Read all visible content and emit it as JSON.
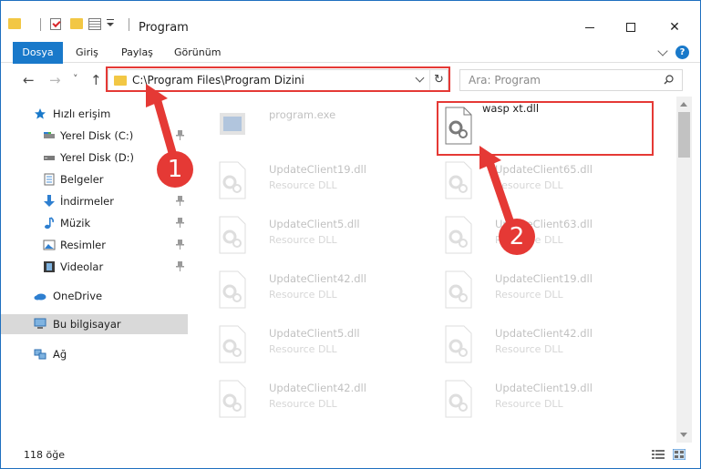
{
  "window": {
    "title": "Program",
    "quick_access_dropdown": "▾",
    "minimize": "—",
    "maximize": "☐",
    "close": "✕"
  },
  "ribbon": {
    "tabs": [
      "Dosya",
      "Giriş",
      "Paylaş",
      "Görünüm"
    ],
    "help": "?"
  },
  "address_bar": {
    "back": "←",
    "forward": "→",
    "recent": "˅",
    "up": "↑",
    "path": "C:\\Program Files\\Program Dizini",
    "refresh": "↻"
  },
  "search": {
    "placeholder": "Ara: Program"
  },
  "sidebar": {
    "items": [
      {
        "label": "Hızlı erişim",
        "icon": "star-icon",
        "pinned": false
      },
      {
        "label": "Yerel Disk (C:)",
        "icon": "drive-icon",
        "pinned": true
      },
      {
        "label": "Yerel Disk (D:)",
        "icon": "drive-icon",
        "pinned": false
      },
      {
        "label": "Belgeler",
        "icon": "documents-icon",
        "pinned": true
      },
      {
        "label": "İndirmeler",
        "icon": "download-icon",
        "pinned": true
      },
      {
        "label": "Müzik",
        "icon": "music-icon",
        "pinned": true
      },
      {
        "label": "Resimler",
        "icon": "pictures-icon",
        "pinned": true
      },
      {
        "label": "Videolar",
        "icon": "videos-icon",
        "pinned": true
      },
      {
        "label": "OneDrive",
        "icon": "cloud-icon",
        "pinned": false
      },
      {
        "label": "Bu bilgisayar",
        "icon": "computer-icon",
        "pinned": false,
        "selected": true
      },
      {
        "label": "Ağ",
        "icon": "network-icon",
        "pinned": false
      }
    ]
  },
  "files": {
    "left": [
      {
        "name": "program.exe",
        "type": "",
        "icon": "exe-icon"
      },
      {
        "name": "UpdateClient19.dll",
        "type": "Resource DLL",
        "icon": "dll-icon"
      },
      {
        "name": "UpdateClient5.dll",
        "type": "Resource DLL",
        "icon": "dll-icon"
      },
      {
        "name": "UpdateClient42.dll",
        "type": "Resource DLL",
        "icon": "dll-icon"
      },
      {
        "name": "UpdateClient5.dll",
        "type": "Resource DLL",
        "icon": "dll-icon"
      },
      {
        "name": "UpdateClient42.dll",
        "type": "Resource DLL",
        "icon": "dll-icon"
      }
    ],
    "right": [
      {
        "name": "wasp xt.dll",
        "type": "",
        "icon": "dll-icon",
        "highlighted": true
      },
      {
        "name": "UpdateClient65.dll",
        "type": "Resource DLL",
        "icon": "dll-icon"
      },
      {
        "name": "UpdateClient63.dll",
        "type": "Resource DLL",
        "icon": "dll-icon"
      },
      {
        "name": "UpdateClient19.dll",
        "type": "Resource DLL",
        "icon": "dll-icon"
      },
      {
        "name": "UpdateClient42.dll",
        "type": "Resource DLL",
        "icon": "dll-icon"
      },
      {
        "name": "UpdateClient19.dll",
        "type": "Resource DLL",
        "icon": "dll-icon"
      }
    ]
  },
  "status_bar": {
    "item_count": "118 öğe"
  },
  "callouts": {
    "step1": "1",
    "step2": "2"
  },
  "colors": {
    "accent": "#1979ca",
    "highlight": "#e53935",
    "folder": "#f2c744"
  }
}
